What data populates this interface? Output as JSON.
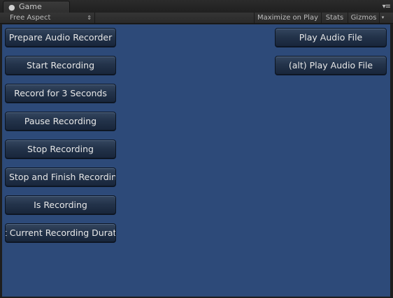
{
  "window": {
    "tab_icon": "pacman-icon",
    "tab_title": "Game",
    "menu_icon": "hamburger-menu-icon"
  },
  "toolbar": {
    "aspect_label": "Free Aspect",
    "maximize_label": "Maximize on Play",
    "stats_label": "Stats",
    "gizmos_label": "Gizmos"
  },
  "colors": {
    "viewport_background": "#2d4a79",
    "button_text": "#e8e8e8"
  },
  "left_buttons": [
    "Prepare Audio Recorder",
    "Start Recording",
    "Record for 3 Seconds",
    "Pause Recording",
    "Stop Recording",
    "Stop and Finish Recording",
    "Is Recording",
    "Get Current Recording Duration"
  ],
  "right_buttons": [
    "Play Audio File",
    "(alt) Play Audio File"
  ]
}
